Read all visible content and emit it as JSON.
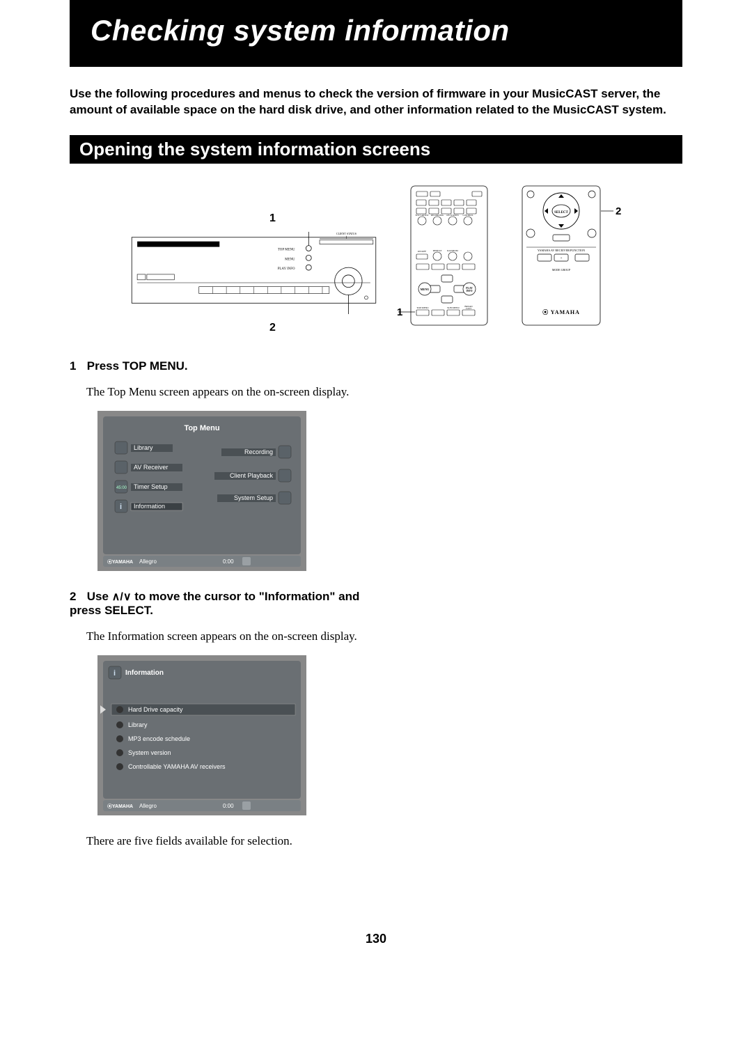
{
  "title": "Checking system information",
  "intro": "Use the following procedures and menus to check the version of firmware in your MusicCAST server, the amount of available space on the hard disk drive, and other information related to the MusicCAST system.",
  "section_heading": "Opening the system information screens",
  "callouts": {
    "one": "1",
    "two": "2"
  },
  "brand": "YAMAHA",
  "steps": [
    {
      "num": "1",
      "head": "Press TOP MENU.",
      "body": "The Top Menu screen appears on the on-screen display."
    },
    {
      "num": "2",
      "head_prefix": "Use ",
      "head_suffix": " to move the cursor to \"Information\" and press SELECT.",
      "body": "The Information screen appears on the on-screen display."
    }
  ],
  "top_menu_screen": {
    "title": "Top Menu",
    "left_items": [
      "Library",
      "AV Receiver",
      "Timer Setup",
      "Information"
    ],
    "right_items": [
      "Recording",
      "Client Playback",
      "System Setup"
    ],
    "footer_brand": "YAMAHA",
    "footer_track": "Allegro",
    "footer_time": "0:00"
  },
  "info_screen": {
    "title": "Information",
    "items": [
      "Hard Drive capacity",
      "Library",
      "MP3 encode schedule",
      "System version",
      "Controllable YAMAHA AV receivers"
    ],
    "footer_brand": "YAMAHA",
    "footer_track": "Allegro",
    "footer_time": "0:00"
  },
  "step2_extra": "There are five fields available for selection.",
  "arrows": "∧/∨",
  "page_number": "130",
  "remote_labels": {
    "select": "SELECT",
    "menu": "MENU",
    "play_info": "PLAY INFO",
    "top_menu": "TOP MENU",
    "sub_menu": "SUB MENU",
    "broadcast": "BROAD CAST",
    "receiver_function": "YAMAHA AV RECEIVER/FUNCTION"
  }
}
